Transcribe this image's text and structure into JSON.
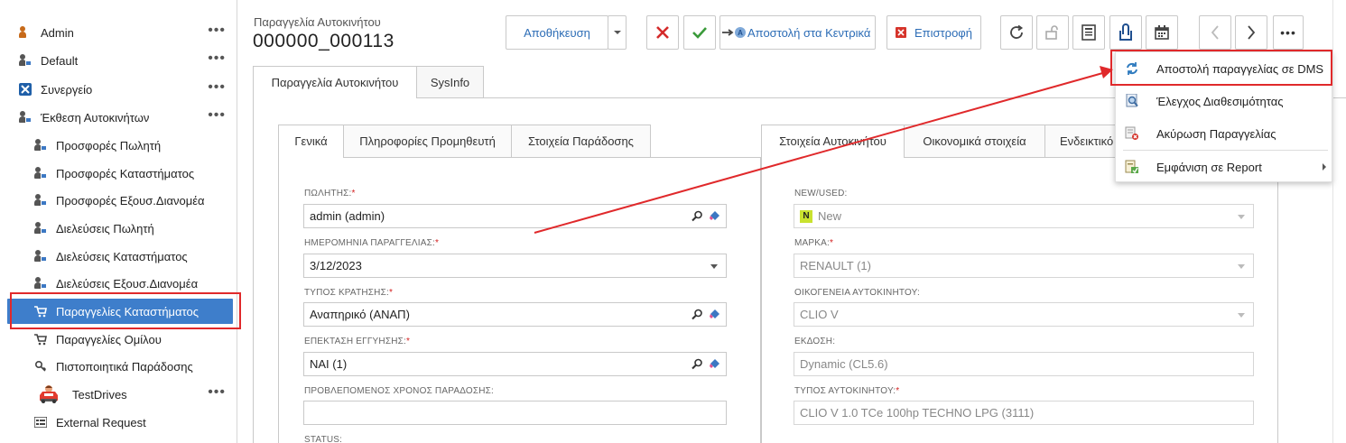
{
  "sidebar": {
    "items": [
      {
        "label": "Admin",
        "icon": "admin-user-icon",
        "dots": "•••"
      },
      {
        "label": "Default",
        "icon": "user-icon",
        "dots": "•••"
      },
      {
        "label": "Συνεργείο",
        "icon": "tools-icon",
        "dots": "•••"
      },
      {
        "label": "Έκθεση Αυτοκινήτων",
        "icon": "user-icon",
        "dots": "•••"
      },
      {
        "label": "Προσφορές Πωλητή",
        "icon": "user-icon"
      },
      {
        "label": "Προσφορές Καταστήματος",
        "icon": "user-icon"
      },
      {
        "label": "Προσφορές Εξουσ.Διανομέα",
        "icon": "user-icon"
      },
      {
        "label": "Διελεύσεις Πωλητή",
        "icon": "user-icon"
      },
      {
        "label": "Διελεύσεις Καταστήματος",
        "icon": "user-icon"
      },
      {
        "label": "Διελεύσεις Εξουσ.Διανομέα",
        "icon": "user-icon"
      },
      {
        "label": "Παραγγελίες Καταστήματος",
        "icon": "cart-icon",
        "active": true
      },
      {
        "label": "Παραγγελίες Ομίλου",
        "icon": "cart-icon"
      },
      {
        "label": "Πιστοποιητικά Παράδοσης",
        "icon": "key-icon"
      },
      {
        "label": "TestDrives",
        "icon": "car-icon",
        "dots": "•••"
      },
      {
        "label": "External Request",
        "icon": "list-icon"
      }
    ]
  },
  "header": {
    "subtitle": "Παραγγελία Αυτοκινήτου",
    "title": "000000_000113"
  },
  "toolbar": {
    "save_label": "Αποθήκευση",
    "send_central_label": "Αποστολή στα Κεντρικά",
    "send_central_badge": "A",
    "return_label": "Επιστροφή",
    "more_label": "•••"
  },
  "main_tabs": [
    {
      "label": "Παραγγελία Αυτοκινήτου"
    },
    {
      "label": "SysInfo"
    }
  ],
  "left_tabs": [
    {
      "label": "Γενικά"
    },
    {
      "label": "Πληροφορίες Προμηθευτή"
    },
    {
      "label": "Στοιχεία Παράδοσης"
    }
  ],
  "right_tabs": [
    {
      "label": "Στοιχεία Αυτοκινήτου"
    },
    {
      "label": "Οικονομικά στοιχεία"
    },
    {
      "label": "Ενδεικτικό"
    }
  ],
  "left_fields": {
    "seller": {
      "label": "ΠΩΛΗΤΗΣ:",
      "req": "*",
      "value": "admin  (admin)"
    },
    "order_date": {
      "label": "ΗΜΕΡΟΜΗΝΙΑ ΠΑΡΑΓΓΕΛΙΑΣ:",
      "req": "*",
      "value": "3/12/2023"
    },
    "booking_type": {
      "label": "ΤΥΠΟΣ ΚΡΑΤΗΣΗΣ:",
      "req": "*",
      "value": "Αναπηρικό (ΑΝΑΠ)"
    },
    "warranty": {
      "label": "ΕΠΕΚΤΑΣΗ ΕΓΓΥΗΣΗΣ:",
      "req": "*",
      "value": "ΝΑΙ (1)"
    },
    "delivery_time": {
      "label": "ΠΡΟΒΛΕΠΟΜΕΝΟΣ ΧΡΟΝΟΣ ΠΑΡΑΔΟΣΗΣ:",
      "value": ""
    },
    "status": {
      "label": "STATUS:"
    }
  },
  "right_fields": {
    "new_used": {
      "label": "NEW/USED:",
      "badge": "N",
      "value": "New"
    },
    "brand": {
      "label": "ΜΑΡΚΑ:",
      "req": "*",
      "value": "RENAULT (1)"
    },
    "family": {
      "label": "ΟΙΚΟΓΕΝΕΙΑ ΑΥΤΟΚΙΝΗΤΟΥ:",
      "value": "CLIO V"
    },
    "edition": {
      "label": "ΕΚΔΟΣΗ:",
      "value": "Dynamic (CL5.6)"
    },
    "car_type": {
      "label": "ΤΥΠΟΣ ΑΥΤΟΚΙΝΗΤΟΥ:",
      "req": "*",
      "value": "CLIO V 1.0 TCe 100hp TECHNO LPG (3111)"
    }
  },
  "dropdown_menu": {
    "items": [
      {
        "label": "Αποστολή παραγγελίας σε DMS",
        "icon": "refresh-icon"
      },
      {
        "label": "Έλεγχος Διαθεσιμότητας",
        "icon": "magnifier-document-icon"
      },
      {
        "label": "Ακύρωση Παραγγελίας",
        "icon": "cancel-document-icon"
      },
      {
        "label": "Εμφάνιση σε Report",
        "icon": "report-icon"
      }
    ]
  },
  "colors": {
    "accent": "#3e7ecb",
    "highlight": "#e0292b",
    "link": "#2d6db6"
  }
}
